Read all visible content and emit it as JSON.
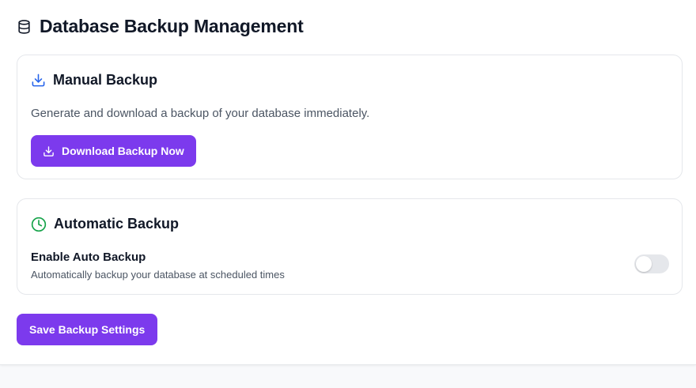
{
  "page": {
    "title": "Database Backup Management",
    "title_icon": "database-icon"
  },
  "manual_backup": {
    "title": "Manual Backup",
    "icon": "download-icon",
    "description": "Generate and download a backup of your database immediately.",
    "button_label": "Download Backup Now",
    "button_icon": "download-icon"
  },
  "automatic_backup": {
    "title": "Automatic Backup",
    "icon": "clock-icon",
    "setting_label": "Enable Auto Backup",
    "setting_help": "Automatically backup your database at scheduled times",
    "enabled": false
  },
  "actions": {
    "save_label": "Save Backup Settings"
  },
  "colors": {
    "accent": "#7c3aed",
    "manual_icon": "#2563eb",
    "auto_icon": "#16a34a",
    "toggle_off": "#e5e7eb"
  }
}
